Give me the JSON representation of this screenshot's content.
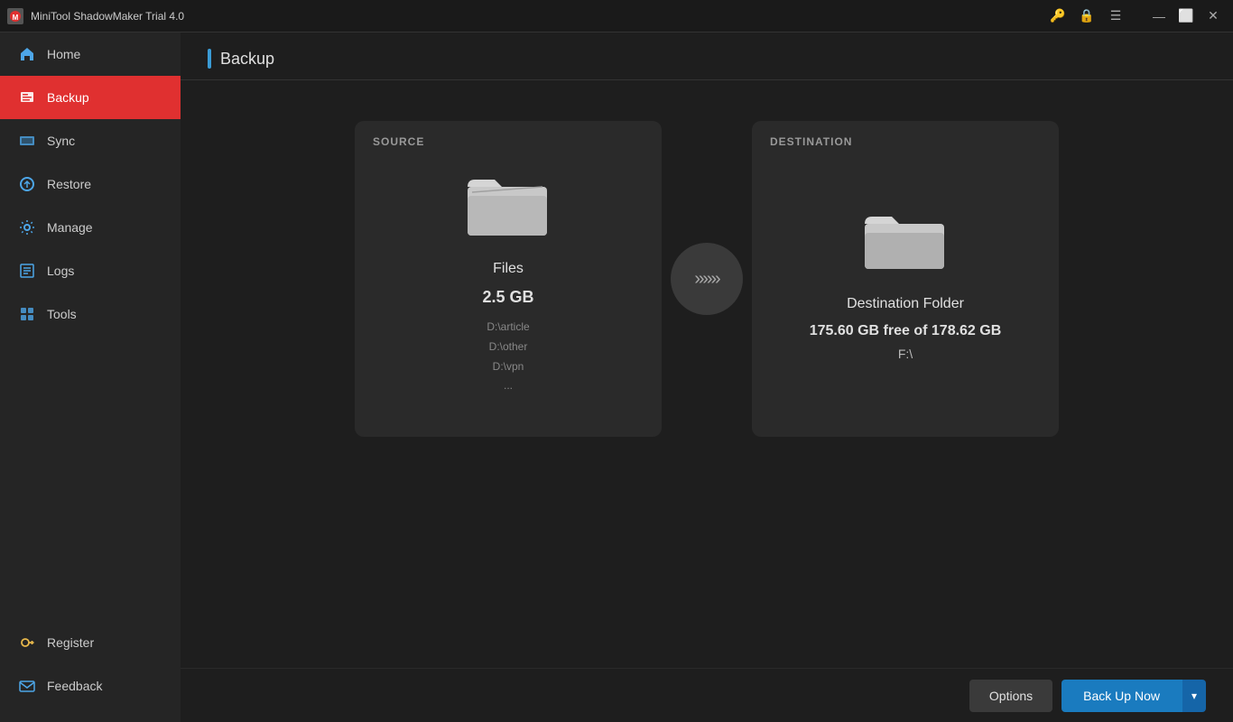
{
  "titleBar": {
    "appTitle": "MiniTool ShadowMaker Trial 4.0",
    "icons": [
      "key-icon",
      "lock-icon",
      "menu-icon"
    ],
    "winControls": [
      "minimize",
      "maximize",
      "close"
    ]
  },
  "sidebar": {
    "navItems": [
      {
        "id": "home",
        "label": "Home",
        "icon": "home-icon",
        "active": false
      },
      {
        "id": "backup",
        "label": "Backup",
        "icon": "backup-icon",
        "active": true
      },
      {
        "id": "sync",
        "label": "Sync",
        "icon": "sync-icon",
        "active": false
      },
      {
        "id": "restore",
        "label": "Restore",
        "icon": "restore-icon",
        "active": false
      },
      {
        "id": "manage",
        "label": "Manage",
        "icon": "manage-icon",
        "active": false
      },
      {
        "id": "logs",
        "label": "Logs",
        "icon": "logs-icon",
        "active": false
      },
      {
        "id": "tools",
        "label": "Tools",
        "icon": "tools-icon",
        "active": false
      }
    ],
    "bottomItems": [
      {
        "id": "register",
        "label": "Register",
        "icon": "key-icon"
      },
      {
        "id": "feedback",
        "label": "Feedback",
        "icon": "mail-icon"
      }
    ]
  },
  "page": {
    "title": "Backup"
  },
  "source": {
    "label": "SOURCE",
    "title": "Files",
    "size": "2.5 GB",
    "paths": [
      "D:\\article",
      "D:\\other",
      "D:\\vpn",
      "..."
    ]
  },
  "destination": {
    "label": "DESTINATION",
    "title": "Destination Folder",
    "freeSpace": "175.60 GB free of 178.62 GB",
    "drive": "F:\\"
  },
  "toolbar": {
    "optionsLabel": "Options",
    "backupNowLabel": "Back Up Now",
    "dropdownArrow": "▾"
  }
}
